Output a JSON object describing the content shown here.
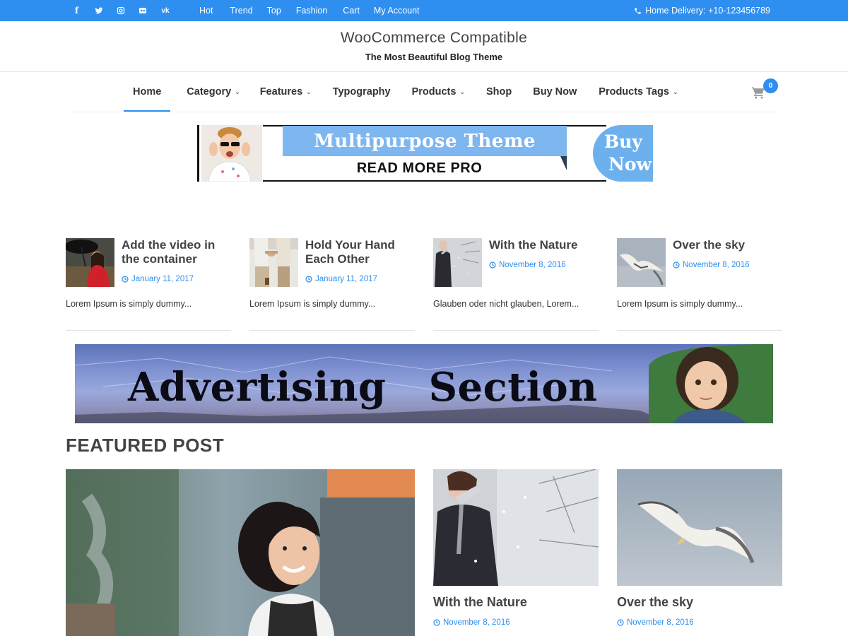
{
  "topbar": {
    "social": [
      {
        "icon": "facebook-icon",
        "glyph": "f"
      },
      {
        "icon": "twitter-icon",
        "glyph": ""
      },
      {
        "icon": "instagram-icon",
        "glyph": ""
      },
      {
        "icon": "flickr-icon",
        "glyph": ""
      },
      {
        "icon": "vk-icon",
        "glyph": "vk"
      }
    ],
    "nav": [
      "Hot",
      "Trend",
      "Top",
      "Fashion",
      "Cart",
      "My Account"
    ],
    "delivery": "Home Delivery: +10-123456789"
  },
  "header": {
    "title": "WooCommerce Compatible",
    "tagline": "The Most Beautiful Blog Theme"
  },
  "mainnav": {
    "items": [
      {
        "label": "Home"
      },
      {
        "label": "Category"
      },
      {
        "label": "Features"
      },
      {
        "label": "Typography"
      },
      {
        "label": "Products"
      },
      {
        "label": "Shop"
      },
      {
        "label": "Buy Now"
      },
      {
        "label": "Products Tags"
      }
    ],
    "active": "Home",
    "cart_count": "0"
  },
  "banner": {
    "headline": "Multipurpose Theme",
    "cta": "READ MORE PRO",
    "buy_line1": "Buy",
    "buy_line2": "Now"
  },
  "posts": [
    {
      "title": "Add the video in the container",
      "date": "January 11, 2017",
      "excerpt": "Lorem Ipsum is simply dummy..."
    },
    {
      "title": "Hold Your Hand Each Other",
      "date": "January 11, 2017",
      "excerpt": "Lorem Ipsum is simply dummy..."
    },
    {
      "title": "With the Nature",
      "date": "November 8, 2016",
      "excerpt": "Glauben oder nicht glauben, Lorem..."
    },
    {
      "title": "Over the sky",
      "date": "November 8, 2016",
      "excerpt": "Lorem Ipsum is simply dummy..."
    }
  ],
  "advertising": {
    "text": "Advertising   Section"
  },
  "featured": {
    "heading": "FEATURED POST",
    "cards": [
      {
        "title": "With the Nature",
        "date": "November 8, 2016"
      },
      {
        "title": "Over the sky",
        "date": "November 8, 2016"
      }
    ]
  },
  "colors": {
    "accent": "#2f8ff0",
    "banner_blue": "#7eb6f0",
    "text_dark": "#444444"
  }
}
